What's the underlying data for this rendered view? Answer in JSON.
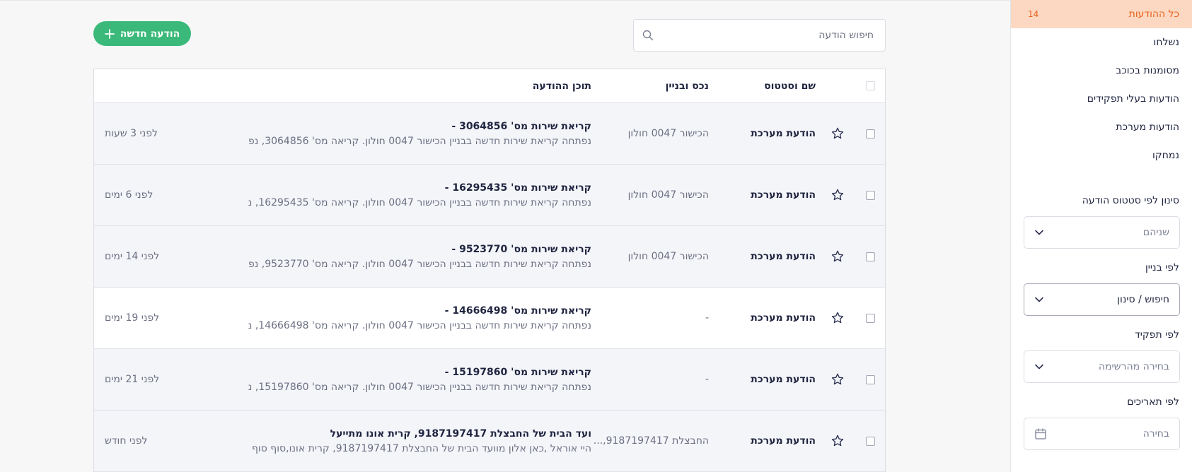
{
  "sidebar": {
    "nav": [
      {
        "label": "כל ההודעות",
        "count": "14",
        "active": true
      },
      {
        "label": "נשלחו"
      },
      {
        "label": "מסומנות בכוכב"
      },
      {
        "label": "הודעות בעלי תפקידים"
      },
      {
        "label": "הודעות מערכת"
      },
      {
        "label": "נמחקו"
      }
    ],
    "filters": {
      "status_label": "סינון לפי סטטוס הודעה",
      "status_value": "שניהם",
      "building_label": "לפי בניין",
      "building_value": "חיפוש / סינון",
      "role_label": "לפי תפקיד",
      "role_value": "בחירה מהרשימה",
      "dates_label": "לפי תאריכים",
      "dates_value": "בחירה"
    }
  },
  "toolbar": {
    "new_message_label": "הודעה חדשה",
    "search_placeholder": "חיפוש הודעה"
  },
  "table": {
    "headers": {
      "name_status": "שם וסטטוס",
      "property": "נכס ובניין",
      "content": "תוכן ההודעה"
    },
    "rows": [
      {
        "name": "הודעת מערכת",
        "property": "הכישור 0047 חולון",
        "subject": "קריאת שירות מס' 3064856 -",
        "body": "נפתחה קריאת שירות חדשה בבניין הכישור 0047 חולון. קריאה מס' 3064856, נפ",
        "time": "לפני 3 שעות"
      },
      {
        "name": "הודעת מערכת",
        "property": "הכישור 0047 חולון",
        "subject": "קריאת שירות מס' 16295435 -",
        "body": "נפתחה קריאת שירות חדשה בבניין הכישור 0047 חולון. קריאה מס' 16295435, נ",
        "time": "לפני 6 ימים"
      },
      {
        "name": "הודעת מערכת",
        "property": "הכישור 0047 חולון",
        "subject": "קריאת שירות מס' 9523770 -",
        "body": "נפתחה קריאת שירות חדשה בבניין הכישור 0047 חולון. קריאה מס' 9523770, נפ",
        "time": "לפני 14 ימים"
      },
      {
        "name": "הודעת מערכת",
        "property": "-",
        "subject": "קריאת שירות מס' 14666498 -",
        "body": "נפתחה קריאת שירות חדשה בבניין הכישור 0047 חולון. קריאה מס' 14666498, נ",
        "time": "לפני 19 ימים"
      },
      {
        "name": "הודעת מערכת",
        "property": "-",
        "subject": "קריאת שירות מס' 15197860 -",
        "body": "נפתחה קריאת שירות חדשה בבניין הכישור 0047 חולון. קריאה מס' 15197860, נ",
        "time": "לפני 21 ימים"
      },
      {
        "name": "הודעת מערכת",
        "property": "החבצלת 9187197417,...",
        "subject": "ועד הבית של החבצלת 9187197417, קרית אונו מתייעל",
        "body": "היי אוראל ,כאן אלון מוועד הבית של החבצלת 9187197417, קרית אונו,סוף סוף",
        "time": "לפני חודש"
      }
    ]
  },
  "colors": {
    "accent": "#e8611a",
    "active_bg": "#fcd8c2",
    "primary_button": "#3bb97a"
  }
}
